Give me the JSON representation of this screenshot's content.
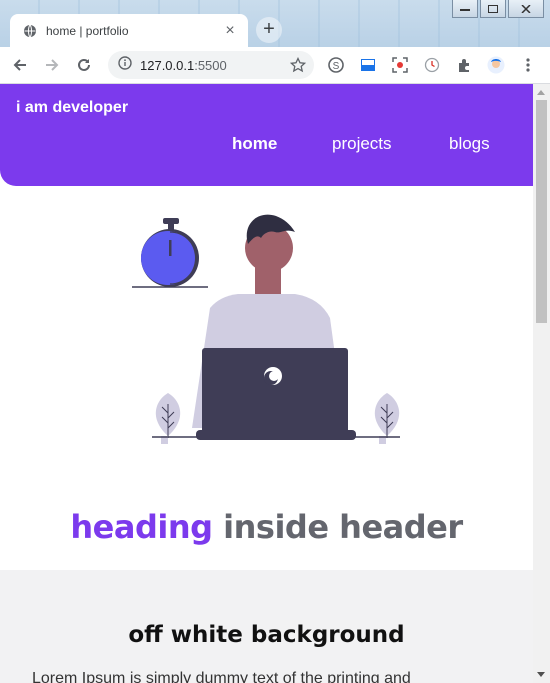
{
  "browser": {
    "tab": {
      "title": "home | portfolio",
      "close": "×"
    },
    "new_tab": "+",
    "url": {
      "host": "127.0.0.1",
      "port": ":5500"
    }
  },
  "site": {
    "brand": "i am developer",
    "nav": [
      {
        "label": "home",
        "active": true
      },
      {
        "label": "projects",
        "active": false
      },
      {
        "label": "blogs",
        "active": false
      }
    ],
    "hero": {
      "heading_accent": "heading",
      "heading_rest": "inside header"
    },
    "section": {
      "title": "off white background",
      "text": "Lorem Ipsum is simply dummy text of the printing and"
    }
  },
  "colors": {
    "accent": "#7c3aed",
    "heading_gray": "#64666e",
    "offwhite": "#f2f2f3",
    "illustration_blue": "#5b5bf0",
    "illustration_dark": "#3f3d56",
    "illustration_skin": "#a0616a",
    "illustration_shirt": "#d0cde1"
  },
  "icons": [
    "globe-icon",
    "close-icon",
    "back-icon",
    "forward-icon",
    "reload-icon",
    "info-icon",
    "star-icon",
    "skype-icon",
    "extension-icon",
    "screenshot-icon",
    "clock-icon",
    "puzzle-icon",
    "avatar-icon"
  ]
}
